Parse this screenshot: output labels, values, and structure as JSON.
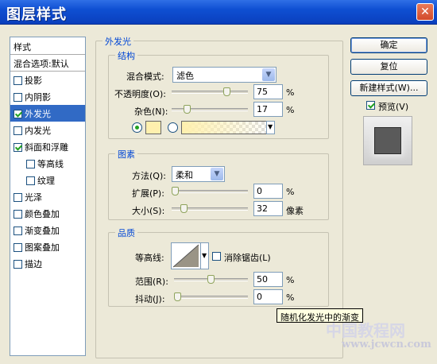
{
  "window": {
    "title": "图层样式",
    "close_glyph": "✕"
  },
  "style_list": {
    "header": "样式",
    "blend_options": "混合选项:默认",
    "items": [
      {
        "label": "投影",
        "checked": false,
        "selected": false,
        "sub": false
      },
      {
        "label": "内阴影",
        "checked": false,
        "selected": false,
        "sub": false
      },
      {
        "label": "外发光",
        "checked": true,
        "selected": true,
        "sub": false
      },
      {
        "label": "内发光",
        "checked": false,
        "selected": false,
        "sub": false
      },
      {
        "label": "斜面和浮雕",
        "checked": true,
        "selected": false,
        "sub": false
      },
      {
        "label": "等高线",
        "checked": false,
        "selected": false,
        "sub": true
      },
      {
        "label": "纹理",
        "checked": false,
        "selected": false,
        "sub": true
      },
      {
        "label": "光泽",
        "checked": false,
        "selected": false,
        "sub": false
      },
      {
        "label": "颜色叠加",
        "checked": false,
        "selected": false,
        "sub": false
      },
      {
        "label": "渐变叠加",
        "checked": false,
        "selected": false,
        "sub": false
      },
      {
        "label": "图案叠加",
        "checked": false,
        "selected": false,
        "sub": false
      },
      {
        "label": "描边",
        "checked": false,
        "selected": false,
        "sub": false
      }
    ]
  },
  "outer_glow": {
    "title": "外发光",
    "structure": {
      "title": "结构",
      "blend_mode_label": "混合模式:",
      "blend_mode_value": "滤色",
      "opacity_label": "不透明度(O):",
      "opacity_value": "75",
      "opacity_unit": "%",
      "opacity_fraction": 0.75,
      "noise_label": "杂色(N):",
      "noise_value": "17",
      "noise_unit": "%",
      "noise_fraction": 0.17,
      "glow_color": "#fff0ae"
    },
    "elements": {
      "title": "图素",
      "method_label": "方法(Q):",
      "method_value": "柔和",
      "spread_label": "扩展(P):",
      "spread_value": "0",
      "spread_unit": "%",
      "spread_fraction": 0.0,
      "size_label": "大小(S):",
      "size_value": "32",
      "size_unit": "像素",
      "size_fraction": 0.13
    },
    "quality": {
      "title": "品质",
      "contour_label": "等高线:",
      "antialias_label": "消除锯齿(L)",
      "range_label": "范围(R):",
      "range_value": "50",
      "range_unit": "%",
      "range_fraction": 0.5,
      "jitter_label": "抖动(J):",
      "jitter_value": "0",
      "jitter_unit": "%",
      "jitter_fraction": 0.0
    }
  },
  "buttons": {
    "ok": "确定",
    "reset": "复位",
    "new_style": "新建样式(W)...",
    "preview": "预览(V)"
  },
  "tooltip": "随机化发光中的渐变",
  "watermark": {
    "line1": "中国教程网",
    "line2": "www.jcwcn.com"
  }
}
